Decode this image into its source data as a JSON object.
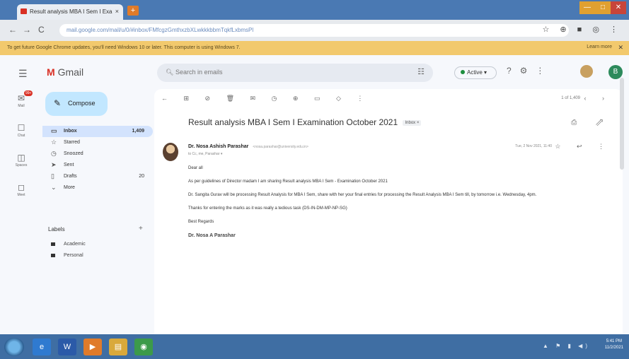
{
  "browser": {
    "tab_title": "Result analysis MBA I Sem I Exa",
    "tab_close": "×",
    "new_tab": "+",
    "window_controls": [
      "—",
      "□",
      "✕"
    ],
    "url": "mail.google.com/mail/u/0/#inbox/FMfcgzGmthxzbXLwkkkbbmTqkfLxbmsPl",
    "nav_back": "←",
    "nav_forward": "→",
    "nav_reload": "C",
    "addr_icons": "☆ ⊕ ■ ◎ ⋮",
    "infobar_text": "To get future Google Chrome updates, you'll need Windows 10 or later. This computer is using Windows 7.",
    "infobar_link": "Learn more",
    "infobar_close": "✕"
  },
  "gmail": {
    "logo_text": "Gmail",
    "search_placeholder": "Search in emails",
    "status_label": "Active",
    "avatar_letter": "B",
    "compose_label": "Compose",
    "rail": [
      {
        "icon": "✉",
        "label": "Mail",
        "badge": "99+"
      },
      {
        "icon": "☐",
        "label": "Chat"
      },
      {
        "icon": "◫",
        "label": "Spaces"
      },
      {
        "icon": "◻",
        "label": "Meet"
      }
    ],
    "nav_items": [
      {
        "icon": "▭",
        "label": "Inbox",
        "count": "1,409"
      },
      {
        "icon": "☆",
        "label": "Starred",
        "count": ""
      },
      {
        "icon": "◷",
        "label": "Snoozed",
        "count": ""
      },
      {
        "icon": "➤",
        "label": "Sent",
        "count": ""
      },
      {
        "icon": "▯",
        "label": "Drafts",
        "count": "20"
      },
      {
        "icon": "⌄",
        "label": "More",
        "count": ""
      }
    ],
    "labels_title": "Labels",
    "labels_plus": "+",
    "labels": [
      "Academic",
      "Personal"
    ],
    "toolbar_icons": "← ⊞ ⊘ 🗑 ✉ ◷ ⊕ ▭ ◇ ⋮",
    "pager_text": "1 of 1,409",
    "pager_nav": "‹ ›",
    "subject": "Result analysis MBA I Sem I Examination October 2021",
    "subject_tag": "Inbox ×",
    "subject_icons": "⎙ ⇗",
    "sender_name": "Dr. Nosa Ashish Parashar",
    "sender_email": "<nosa.parashar@university.edu.in>",
    "recipient": "to Cc, me, Parashar ▾",
    "msg_meta": "Tue, 2 Nov 2021, 11:40",
    "msg_icons": "☆ ↩ ⋮",
    "body": [
      "Dear all",
      "As per guidelines of Director madam I am sharing Result analysis MBA I Sem - Examination October 2021",
      "Dr. Sangita Gurav will be processing Result Analysis for MBA I Sem, share with her your final entries for processing the Result Analysis MBA I Sem till, by tomorrow i.e. Wednesday, 4pm.",
      "Thanks for entering the marks as it was really a tedious task (DS-IN-DM-MP-NP-SG)",
      "Best Regards"
    ],
    "signature": "Dr. Nosa A Parashar"
  },
  "taskbar": {
    "apps": [
      {
        "name": "ie",
        "glyph": "e",
        "color": "#2f7ad0"
      },
      {
        "name": "word",
        "glyph": "W",
        "color": "#2b5aa8"
      },
      {
        "name": "media",
        "glyph": "▶",
        "color": "#e07b2a"
      },
      {
        "name": "explorer",
        "glyph": "▤",
        "color": "#d9a93b"
      },
      {
        "name": "chrome",
        "glyph": "◉",
        "color": "#3c9a4a"
      }
    ],
    "tray_icons": "▲ ⚑ ▮ ◀)",
    "clock_time": "5:41 PM",
    "clock_date": "11/2/2021"
  }
}
